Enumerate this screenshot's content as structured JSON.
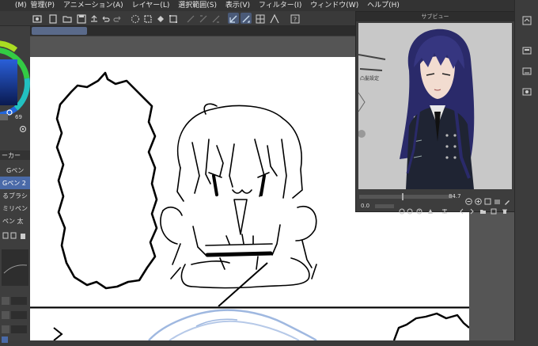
{
  "menu": {
    "items": [
      "(M)",
      "管理(P)",
      "アニメーション(A)",
      "レイヤー(L)",
      "選択範囲(S)",
      "表示(V)",
      "フィルター(I)",
      "ウィンドウ(W)",
      "ヘルプ(H)"
    ]
  },
  "tool_panel": {
    "tab_label": "ーカー",
    "zoom_value": "69",
    "brushes": [
      "Gペン",
      "Gペン 2",
      "るブラシ",
      "ミリペン",
      "ペン 太"
    ]
  },
  "sub_view": {
    "title": "サブビュー",
    "zoom_value": "84.7",
    "rotation_value": "0.0"
  },
  "colors": {
    "accent": "#4a6aa8",
    "menu_bg": "#333333",
    "panel_bg": "#3e3e3e",
    "canvas_bg": "#555555"
  },
  "icons": [
    "settings-icon",
    "folder-icon",
    "save-icon",
    "undo-icon",
    "redo-icon",
    "lasso-icon",
    "transform-icon",
    "zoom-in-icon",
    "zoom-out-icon",
    "rotate-icon",
    "gear-icon"
  ]
}
